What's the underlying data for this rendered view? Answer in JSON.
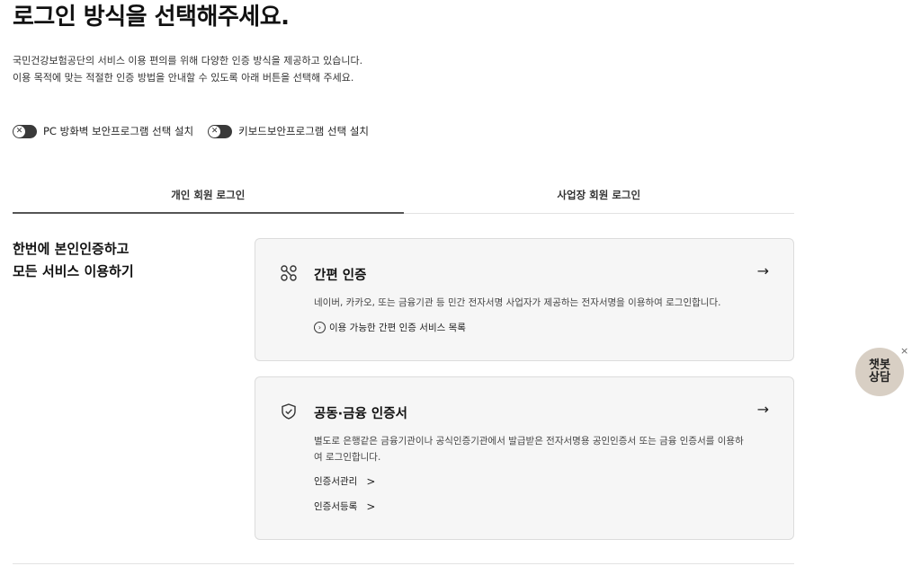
{
  "page": {
    "title": "로그인 방식을 선택해주세요.",
    "description_line1": "국민건강보험공단의 서비스 이용 편의를 위해 다양한 인증 방식을 제공하고 있습니다.",
    "description_line2": "이용 목적에 맞는 적절한 인증 방법을 안내할 수 있도록 아래 버튼을 선택해 주세요."
  },
  "toggles": [
    {
      "label": "PC 방화벽 보안프로그램 선택 설치",
      "knob": "✕"
    },
    {
      "label": "키보드보안프로그램 선택 설치",
      "knob": "✕"
    }
  ],
  "tabs": [
    {
      "label": "개인 회원 로그인",
      "active": true
    },
    {
      "label": "사업장 회원 로그인",
      "active": false
    }
  ],
  "side": {
    "line1": "한번에 본인인증하고",
    "line2": "모든 서비스 이용하기"
  },
  "cards": [
    {
      "title": "간편 인증",
      "icon": "link-chain-icon",
      "arrow": "→",
      "description": "네이버, 카카오, 또는 금융기관 등 민간 전자서명 사업자가 제공하는 전자서명을 이용하여 로그인합니다.",
      "links": [
        {
          "label": "이용 가능한 간편 인증 서비스 목록",
          "marker": "›"
        }
      ]
    },
    {
      "title": "공동·금융 인증서",
      "icon": "shield-check-icon",
      "arrow": "→",
      "description": "별도로 은행같은 금융기관이나 공식인증기관에서 발급받은 전자서명용 공인인증서 또는 금융 인증서를 이용하여 로그인합니다.",
      "links": [
        {
          "label": "인증서관리",
          "marker": ">"
        },
        {
          "label": "인증서등록",
          "marker": ">"
        }
      ]
    }
  ],
  "chatbot": {
    "line1": "챗봇",
    "line2": "상담",
    "close": "×"
  }
}
